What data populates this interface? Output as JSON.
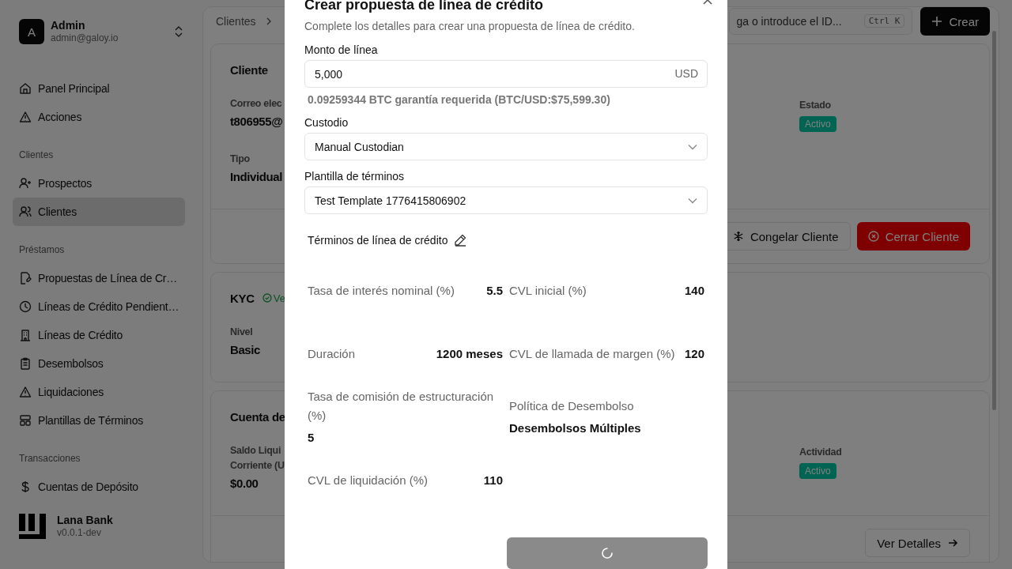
{
  "sidebar": {
    "user": {
      "initial": "A",
      "name": "Admin",
      "email": "admin@galoy.io"
    },
    "sections": [
      {
        "items": [
          {
            "label": "Panel Principal",
            "selected": false
          },
          {
            "label": "Acciones",
            "selected": false
          }
        ]
      },
      {
        "title": "Clientes",
        "items": [
          {
            "label": "Prospectos",
            "selected": false
          },
          {
            "label": "Clientes",
            "selected": true
          }
        ]
      },
      {
        "title": "Préstamos",
        "items": [
          {
            "label": "Propuestas de Línea de Cr…",
            "selected": false
          },
          {
            "label": "Líneas de Crédito Pendient…",
            "selected": false
          },
          {
            "label": "Líneas de Crédito",
            "selected": false
          },
          {
            "label": "Desembolsos",
            "selected": false
          },
          {
            "label": "Liquidaciones",
            "selected": false
          },
          {
            "label": "Plantillas de Términos",
            "selected": false
          }
        ]
      },
      {
        "title": "Transacciones",
        "items": [
          {
            "label": "Cuentas de Depósito",
            "selected": false
          }
        ]
      }
    ],
    "footer": {
      "name": "Lana Bank",
      "version": "v0.0.1-dev"
    }
  },
  "topbar": {
    "breadcrumb": [
      "Clientes"
    ],
    "search": {
      "placeholder": "ga o introduce el ID...",
      "shortcut": "Ctrl K"
    },
    "create_button": "Crear"
  },
  "cards": [
    {
      "title": "Cliente",
      "left": [
        {
          "label": [
            "Correo elec"
          ],
          "value": "t806955@"
        },
        {
          "label": [
            "Tipo"
          ],
          "value": "Individual"
        }
      ],
      "right": {
        "label": "Estado",
        "badge": "Activo"
      },
      "buttons": [
        {
          "label": "Congelar Cliente",
          "kind": "freeze"
        },
        {
          "label": "Cerrar Cliente",
          "kind": "danger"
        }
      ]
    },
    {
      "title": "KYC",
      "verified": "Ve",
      "left": [
        {
          "label": [
            "Nivel"
          ],
          "value": "Basic"
        }
      ]
    },
    {
      "title": "Cuenta de",
      "left": [
        {
          "label": [
            "Saldo Liqui",
            "Corriente (U"
          ],
          "value": "$0.00"
        }
      ],
      "right": {
        "label": "Actividad",
        "badge": "Activo"
      },
      "buttons": [
        {
          "label": "Ver Detalles",
          "kind": "details"
        }
      ]
    }
  ],
  "dialog": {
    "title": "Crear propuesta de línea de crédito",
    "description": "Complete los detalles para crear una propuesta de línea de crédito.",
    "amount": {
      "label": "Monto de línea",
      "value": "5,000",
      "suffix": "USD",
      "hint": "0.09259344 BTC garantía requerida (BTC/USD:$75,599.30)"
    },
    "custodian": {
      "label": "Custodio",
      "value": "Manual Custodian"
    },
    "template": {
      "label": "Plantilla de términos",
      "value": "Test Template 1776415806902"
    },
    "terms_heading": "Términos de línea de crédito",
    "terms": [
      {
        "label": "Tasa de interés nominal (%)",
        "value": "5.5"
      },
      {
        "label": "CVL inicial (%)",
        "value": "140"
      },
      {
        "label": "Duración",
        "value": "1200 meses"
      },
      {
        "label": "CVL de llamada de margen (%)",
        "value": "120"
      },
      {
        "label": "Tasa de comisión de estructuración (%)",
        "value": "5"
      },
      {
        "label": "Política de Desembolso",
        "value": "Desembolsos Múltiples"
      },
      {
        "label": "CVL de liquidación (%)",
        "value": "110"
      }
    ],
    "submit": {
      "loading": true
    }
  }
}
